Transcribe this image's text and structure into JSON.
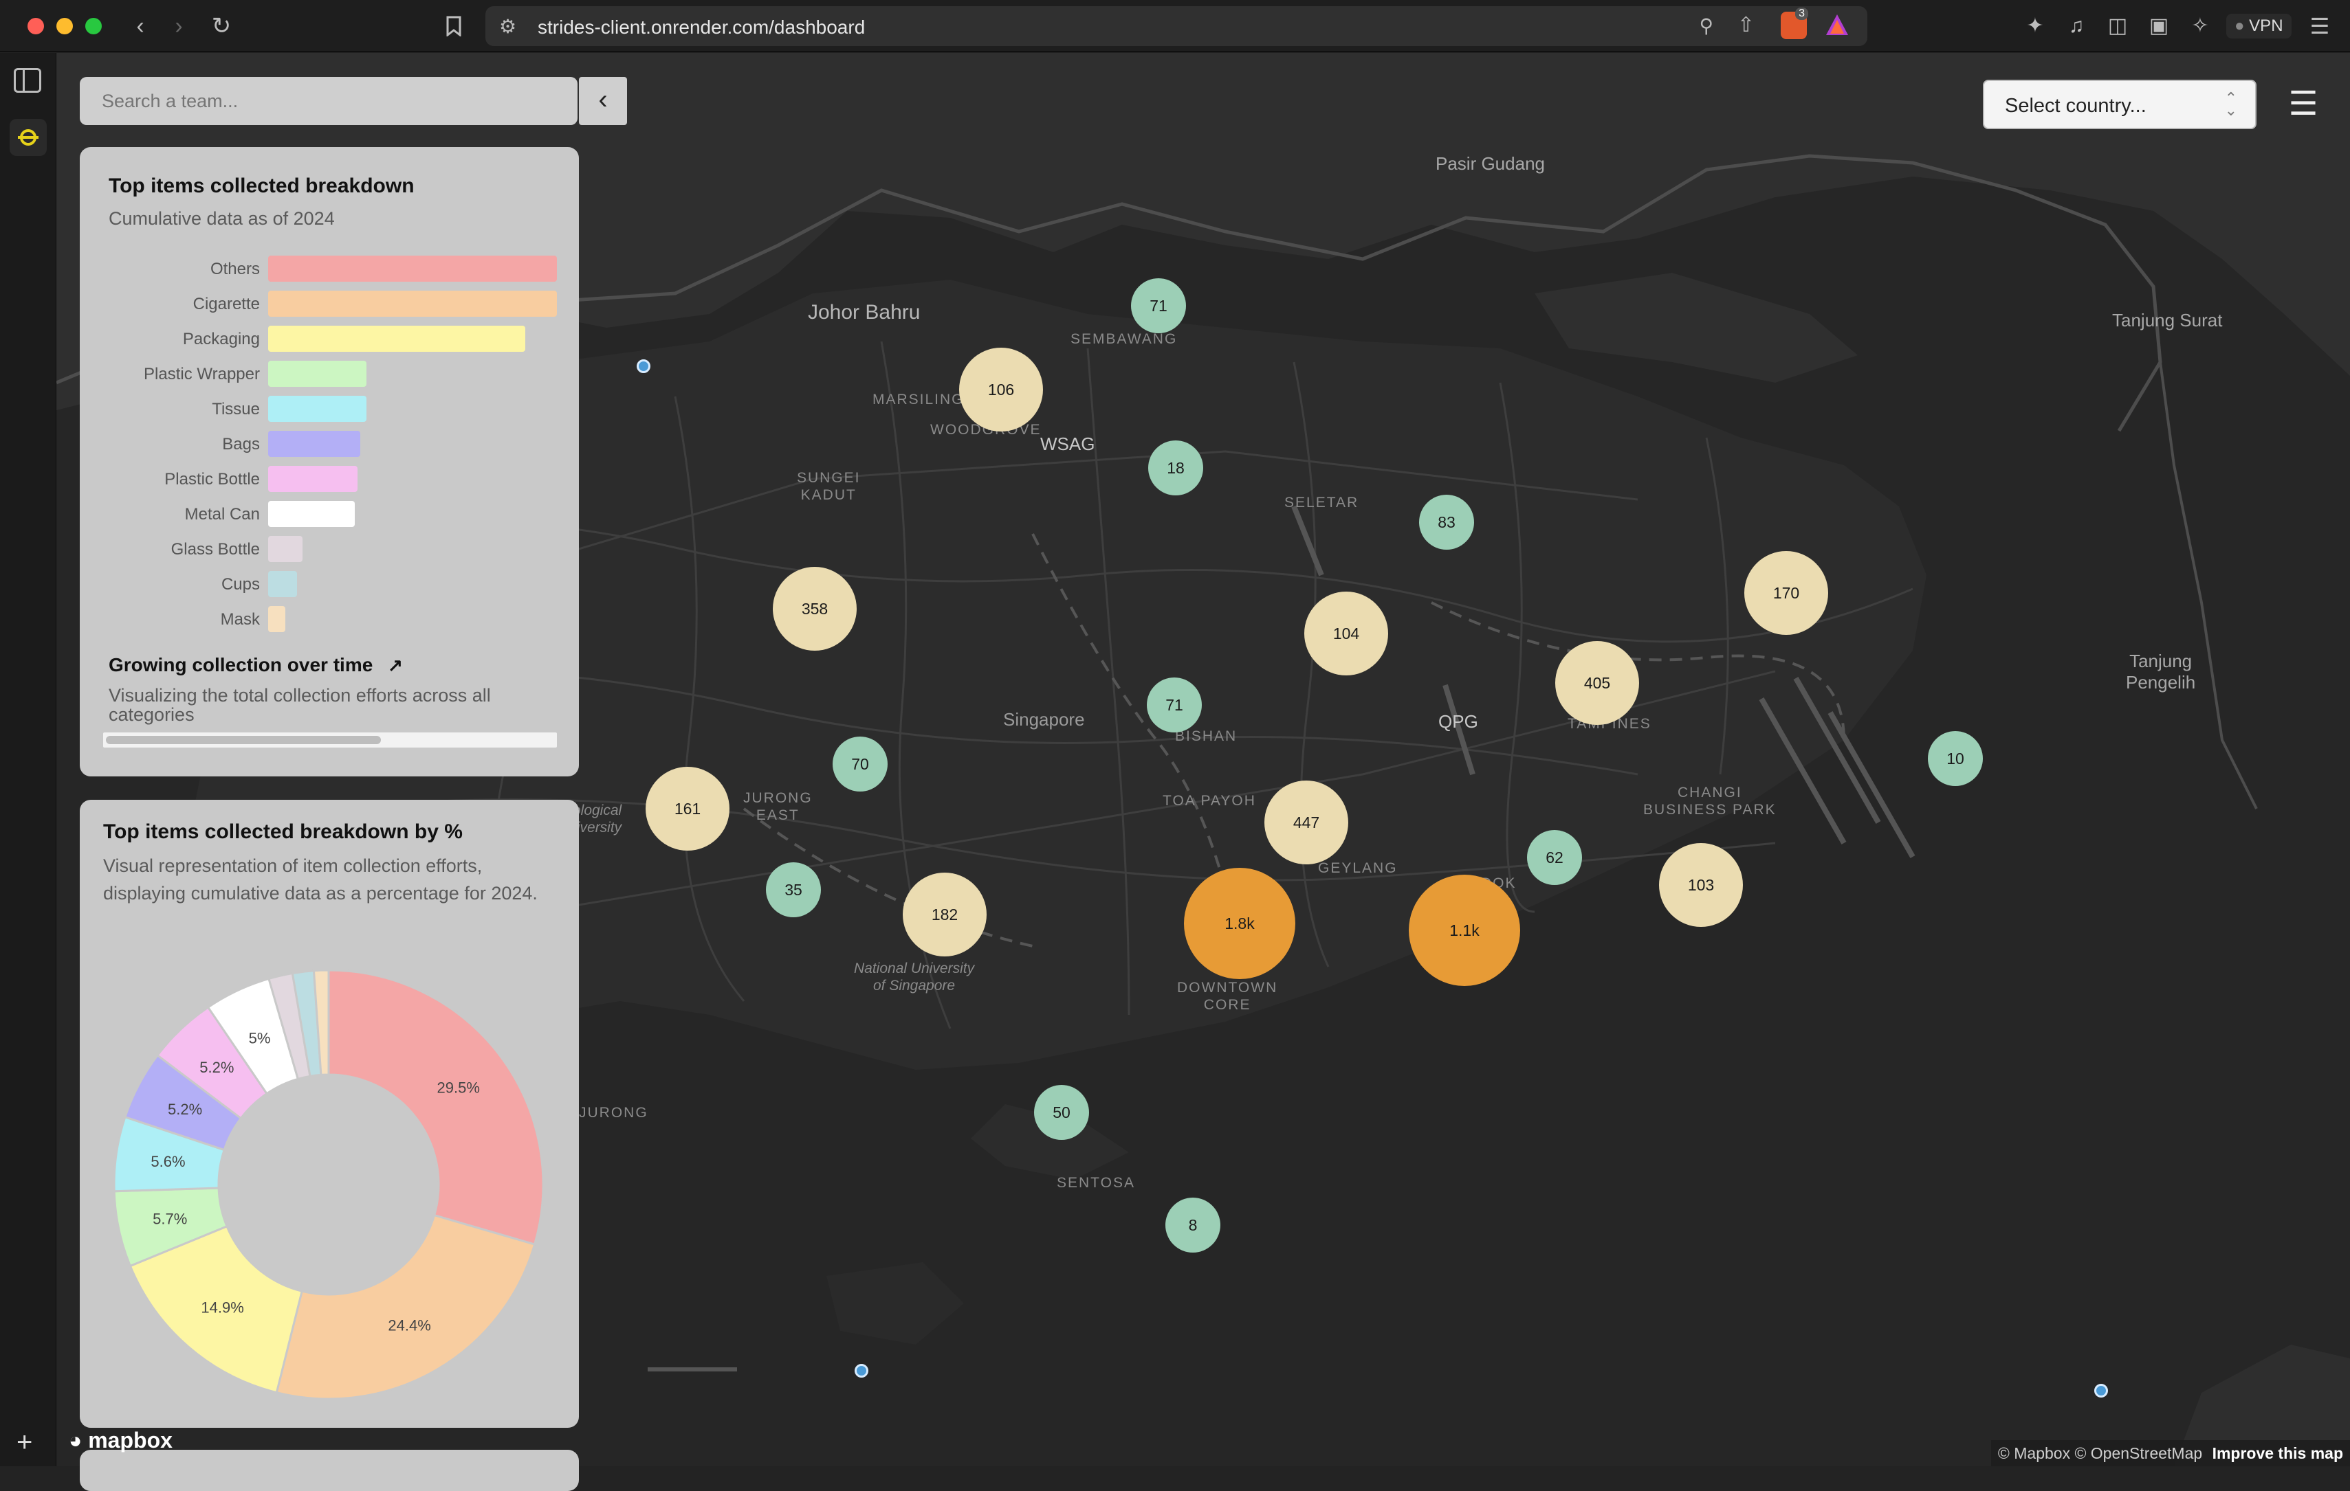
{
  "browser": {
    "url": "strides-client.onrender.com/dashboard",
    "extension_badge": "3",
    "vpn_label": "VPN"
  },
  "search": {
    "placeholder": "Search a team..."
  },
  "breakdown_card": {
    "title": "Top items collected breakdown",
    "subtitle": "Cumulative data as of 2024",
    "items": [
      {
        "label": "Others",
        "value": 1.0,
        "color": "#f4a6a6"
      },
      {
        "label": "Cigarette",
        "value": 1.0,
        "color": "#f8cda0"
      },
      {
        "label": "Packaging",
        "value": 0.89,
        "color": "#fdf6a4"
      },
      {
        "label": "Plastic Wrapper",
        "value": 0.34,
        "color": "#ccf6c2"
      },
      {
        "label": "Tissue",
        "value": 0.34,
        "color": "#aeeff6"
      },
      {
        "label": "Bags",
        "value": 0.32,
        "color": "#b3aff6"
      },
      {
        "label": "Plastic Bottle",
        "value": 0.31,
        "color": "#f6bff0"
      },
      {
        "label": "Metal Can",
        "value": 0.3,
        "color": "#ffffff"
      },
      {
        "label": "Glass Bottle",
        "value": 0.12,
        "color": "#e2d8df"
      },
      {
        "label": "Cups",
        "value": 0.1,
        "color": "#bcdde2"
      },
      {
        "label": "Mask",
        "value": 0.06,
        "color": "#f7e0bf"
      }
    ],
    "growing_title": "Growing collection over time",
    "growing_sub": "Visualizing the total collection efforts across all categories"
  },
  "percent_card": {
    "title": "Top items collected breakdown by %",
    "subtitle": "Visual representation of item collection efforts, displaying cumulative data as a percentage for 2024."
  },
  "chart_data": {
    "type": "pie",
    "donut": true,
    "slices": [
      {
        "label": "Others",
        "value": 29.5,
        "text": "29.5%",
        "color": "#f4a6a6"
      },
      {
        "label": "Cigarette",
        "value": 24.4,
        "text": "24.4%",
        "color": "#f8cda0"
      },
      {
        "label": "Packaging",
        "value": 14.9,
        "text": "14.9%",
        "color": "#fdf6a4"
      },
      {
        "label": "Plastic Wrapper",
        "value": 5.7,
        "text": "5.7%",
        "color": "#ccf6c2"
      },
      {
        "label": "Tissue",
        "value": 5.6,
        "text": "5.6%",
        "color": "#aeeff6"
      },
      {
        "label": "Bags",
        "value": 5.2,
        "text": "5.2%",
        "color": "#b3aff6"
      },
      {
        "label": "Plastic Bottle",
        "value": 5.2,
        "text": "5.2%",
        "color": "#f6bff0"
      },
      {
        "label": "Metal Can",
        "value": 5.0,
        "text": "5%",
        "color": "#ffffff"
      },
      {
        "label": "Glass Bottle",
        "value": 1.8,
        "text": "",
        "color": "#e2d8df"
      },
      {
        "label": "Cups",
        "value": 1.6,
        "text": "",
        "color": "#bcdde2"
      },
      {
        "label": "Mask",
        "value": 1.1,
        "text": "",
        "color": "#f7e0bf"
      }
    ]
  },
  "country_select": {
    "label": "Select country..."
  },
  "map": {
    "places": {
      "johor_bahru": "Johor Bahru",
      "pasir_gudang": "Pasir Gudang",
      "tanjung_surat": "Tanjung Surat",
      "tanjung_pengelih": "Tanjung\nPengelih",
      "sembawang": "SEMBAWANG",
      "marsiling": "MARSILING",
      "woodgrove": "WOODGROVE",
      "wsag": "WSAG",
      "sungei_kadut": "SUNGEI\nKADUT",
      "seletar": "SELETAR",
      "singapore": "Singapore",
      "bishan": "BISHAN",
      "toa_payoh": "TOA PAYOH",
      "qpg": "QPG",
      "tampines": "TAMPINES",
      "jurong_east": "JURONG\nEAST",
      "changi_business_park": "CHANGI\nBUSINESS PARK",
      "geylang": "GEYLANG",
      "bedok": "BEDOK",
      "downtown_core": "DOWNTOWN\nCORE",
      "nus": "National University\nof Singapore",
      "sentosa": "SENTOSA",
      "jurong": "JURONG",
      "ecological": "ological\nUniversity"
    },
    "clusters": [
      {
        "label": "71"
      },
      {
        "label": "106"
      },
      {
        "label": "18"
      },
      {
        "label": "83"
      },
      {
        "label": "358"
      },
      {
        "label": "104"
      },
      {
        "label": "170"
      },
      {
        "label": "71"
      },
      {
        "label": "405"
      },
      {
        "label": "70"
      },
      {
        "label": "161"
      },
      {
        "label": "10"
      },
      {
        "label": "447"
      },
      {
        "label": "62"
      },
      {
        "label": "35"
      },
      {
        "label": "182"
      },
      {
        "label": "1.8k"
      },
      {
        "label": "1.1k"
      },
      {
        "label": "103"
      },
      {
        "label": "50"
      },
      {
        "label": "8"
      }
    ],
    "attribution": "© Mapbox © OpenStreetMap",
    "improve": "Improve this map",
    "logo": "mapbox"
  }
}
